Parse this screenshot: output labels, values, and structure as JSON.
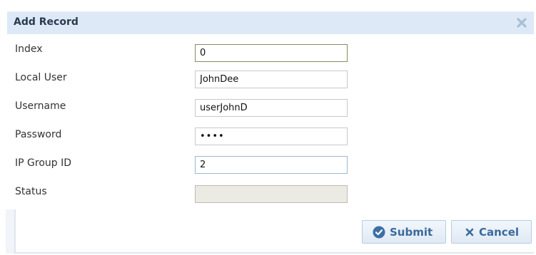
{
  "dialog": {
    "title": "Add Record"
  },
  "form": {
    "index": {
      "label": "Index",
      "value": "0"
    },
    "local_user": {
      "label": "Local User",
      "value": "JohnDee"
    },
    "username": {
      "label": "Username",
      "value": "userJohnD"
    },
    "password": {
      "label": "Password",
      "value": "••••"
    },
    "ip_group_id": {
      "label": "IP Group ID",
      "value": "2"
    },
    "status": {
      "label": "Status",
      "value": ""
    }
  },
  "actions": {
    "submit_label": "Submit",
    "cancel_label": "Cancel"
  },
  "colors": {
    "titlebar": "#dde9f6",
    "button_text": "#3a6a9c",
    "submit_icon": "#3b6fa6"
  },
  "icons": {
    "close": "close-icon",
    "submit": "check-circle-icon",
    "cancel": "x-icon"
  }
}
